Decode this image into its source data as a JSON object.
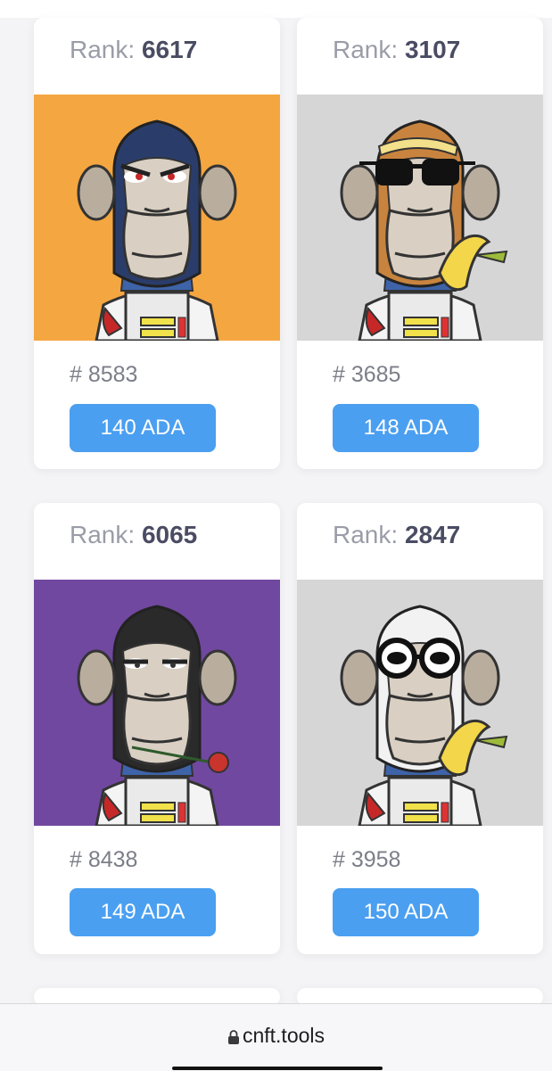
{
  "colors": {
    "accent": "#4a9ff0",
    "rank_label": "#9a9ca8",
    "rank_value": "#4a4c63"
  },
  "cards": [
    {
      "rank_label": "Rank:",
      "rank": "6617",
      "number": "# 8583",
      "price": "140 ADA",
      "bg": "#f4a641",
      "fur": "#2a3d6a",
      "eyes": "angry-red",
      "accessory": "none"
    },
    {
      "rank_label": "Rank:",
      "rank": "3107",
      "number": "# 3685",
      "price": "148 ADA",
      "bg": "#d6d6d6",
      "fur": "#c8843e",
      "eyes": "black-sunglasses",
      "accessory": "banana"
    },
    {
      "rank_label": "Rank:",
      "rank": "6065",
      "number": "# 8438",
      "price": "149 ADA",
      "bg": "#7148a0",
      "fur": "#2a2a2a",
      "eyes": "sleepy",
      "accessory": "rose"
    },
    {
      "rank_label": "Rank:",
      "rank": "2847",
      "number": "# 3958",
      "price": "150 ADA",
      "bg": "#d6d6d6",
      "fur": "#f2f2f2",
      "eyes": "white-round-glasses",
      "accessory": "banana"
    }
  ],
  "address_bar": {
    "url": "cnft.tools",
    "icon": "lock-icon"
  }
}
